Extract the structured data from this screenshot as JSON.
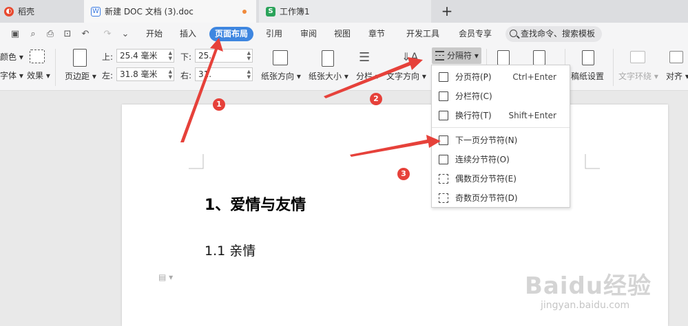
{
  "tabs": {
    "home": "稻壳",
    "doc": "新建 DOC 文档 (3).doc",
    "doc_icon": "W",
    "sheet": "工作簿1",
    "sheet_icon": "S",
    "add": "+"
  },
  "menu": {
    "items": [
      "开始",
      "插入",
      "页面布局",
      "引用",
      "审阅",
      "视图",
      "章节",
      "开发工具",
      "会员专享"
    ],
    "active": "页面布局",
    "search": "查找命令、搜索模板"
  },
  "ribbon": {
    "color_label": "颜色",
    "font_label": "字体",
    "effect_label": "效果",
    "margin_label": "页边距",
    "top_label": "上:",
    "top_value": "25.4 毫米",
    "bottom_label": "下:",
    "bottom_value": "25.",
    "left_label": "左:",
    "left_value": "31.8 毫米",
    "right_label": "右:",
    "right_value": "31.",
    "orientation_label": "纸张方向",
    "size_label": "纸张大小",
    "columns_label": "分栏",
    "text_direction_label": "文字方向",
    "breaks_label": "分隔符",
    "manuscript_label": "稿纸设置",
    "wrap_label": "文字环绕",
    "align_label": "对齐"
  },
  "dropdown": {
    "items": [
      {
        "label": "分页符(P)",
        "shortcut": "Ctrl+Enter",
        "icon": "page-break-icon"
      },
      {
        "label": "分栏符(C)",
        "shortcut": "",
        "icon": "column-break-icon"
      },
      {
        "label": "换行符(T)",
        "shortcut": "Shift+Enter",
        "icon": "line-break-icon"
      },
      {
        "label": "下一页分节符(N)",
        "shortcut": "",
        "icon": "next-page-section-icon"
      },
      {
        "label": "连续分节符(O)",
        "shortcut": "",
        "icon": "continuous-section-icon"
      },
      {
        "label": "偶数页分节符(E)",
        "shortcut": "",
        "icon": "even-page-section-icon"
      },
      {
        "label": "奇数页分节符(D)",
        "shortcut": "",
        "icon": "odd-page-section-icon"
      }
    ]
  },
  "document": {
    "heading1": "1、爱情与友情",
    "heading2": "1.1 亲情"
  },
  "annotations": {
    "badges": [
      "1",
      "2",
      "3"
    ],
    "color": "#e6413a"
  },
  "watermark": {
    "main": "Baidu经验",
    "sub": "jingyan.baidu.com"
  }
}
